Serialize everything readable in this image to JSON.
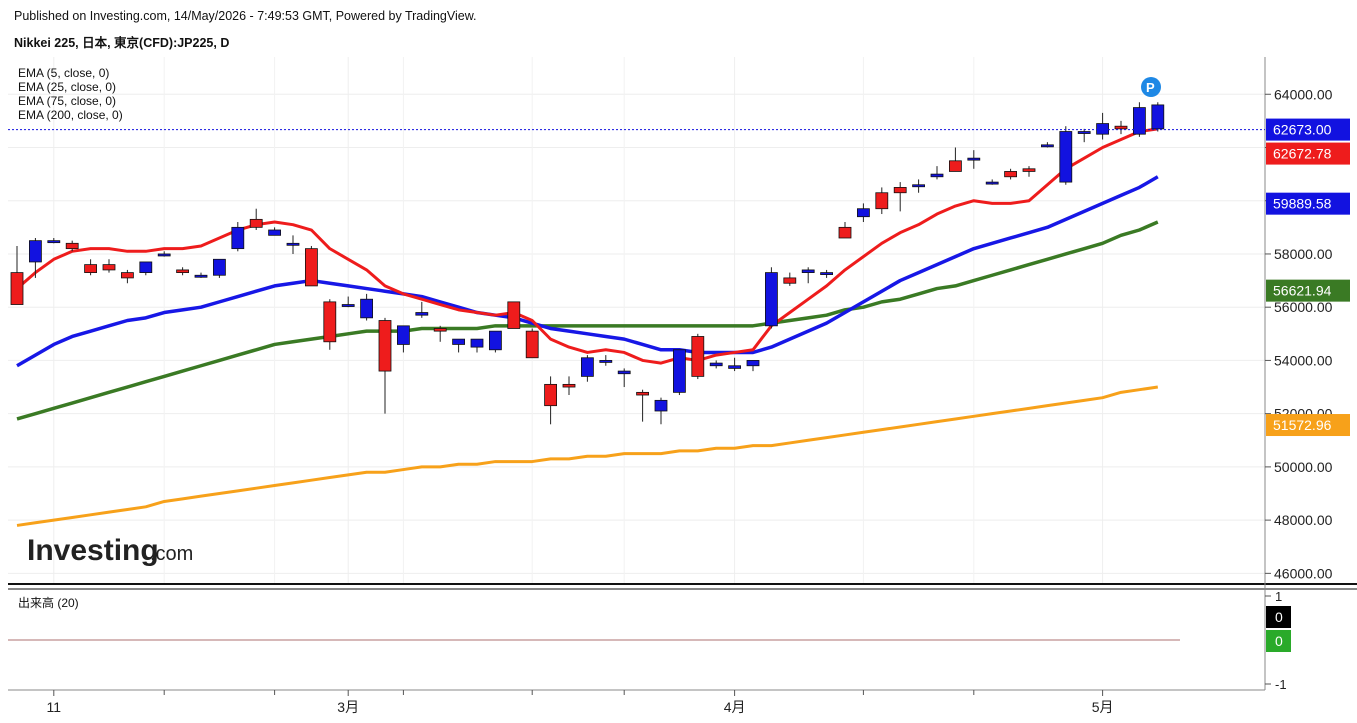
{
  "header": {
    "published": "Published on Investing.com, 14/May/2026 - 7:49:53 GMT, Powered by TradingView.",
    "title": "Nikkei 225, 日本, 東京(CFD):JP225, D"
  },
  "indicators": [
    {
      "label": "EMA (5, close, 0)",
      "color": "#ee1c1c"
    },
    {
      "label": "EMA (25, close, 0)",
      "color": "#1717e6"
    },
    {
      "label": "EMA (75, close, 0)",
      "color": "#3a7a24"
    },
    {
      "label": "EMA (200, close, 0)",
      "color": "#f7a11a"
    }
  ],
  "watermark": {
    "brand": "Investing",
    "suffix": ".com"
  },
  "marker_icon": "p-marker-icon",
  "volume": {
    "label": "出来高 (20)",
    "tick_top": "1",
    "tick_bottom": "-1",
    "value_black": "0",
    "value_green": "0"
  },
  "badges": [
    {
      "text": "62673.00",
      "bg": "#1212e0",
      "price": 62673.0
    },
    {
      "text": "62672.78",
      "bg": "#ee1c1c",
      "price": 62672.78
    },
    {
      "text": "59889.58",
      "bg": "#1212e0",
      "price": 59889.58
    },
    {
      "text": "56621.94",
      "bg": "#3a7a24",
      "price": 56621.94
    },
    {
      "text": "51572.96",
      "bg": "#f7a11a",
      "price": 51572.96
    }
  ],
  "chart_data": {
    "type": "candlestick",
    "price_axis": {
      "ticks": [
        "64000.00",
        "62000.00",
        "60000.00",
        "58000.00",
        "56000.00",
        "54000.00",
        "52000.00",
        "50000.00",
        "48000.00",
        "46000.00"
      ],
      "ylim": [
        45600,
        65400
      ]
    },
    "x_ticks": [
      {
        "label": "11",
        "index": 2
      },
      {
        "label": "3月",
        "index": 18
      },
      {
        "label": "4月",
        "index": 39
      },
      {
        "label": "5月",
        "index": 59
      }
    ],
    "candles": [
      {
        "o": 57300,
        "h": 58300,
        "l": 56400,
        "c": 56100
      },
      {
        "o": 57700,
        "h": 58600,
        "l": 57100,
        "c": 58500
      },
      {
        "o": 58500,
        "h": 58600,
        "l": 58400,
        "c": 58500
      },
      {
        "o": 58400,
        "h": 58500,
        "l": 58100,
        "c": 58200
      },
      {
        "o": 57600,
        "h": 57800,
        "l": 57200,
        "c": 57300
      },
      {
        "o": 57600,
        "h": 57800,
        "l": 57300,
        "c": 57400
      },
      {
        "o": 57300,
        "h": 57400,
        "l": 56900,
        "c": 57100
      },
      {
        "o": 57300,
        "h": 57700,
        "l": 57200,
        "c": 57700
      },
      {
        "o": 58000,
        "h": 58100,
        "l": 57900,
        "c": 58000
      },
      {
        "o": 57400,
        "h": 57500,
        "l": 57200,
        "c": 57300
      },
      {
        "o": 57200,
        "h": 57300,
        "l": 57100,
        "c": 57200
      },
      {
        "o": 57200,
        "h": 57800,
        "l": 57100,
        "c": 57800
      },
      {
        "o": 58200,
        "h": 59200,
        "l": 58100,
        "c": 59000
      },
      {
        "o": 59300,
        "h": 59700,
        "l": 58900,
        "c": 59000
      },
      {
        "o": 58700,
        "h": 59000,
        "l": 58700,
        "c": 58900
      },
      {
        "o": 58400,
        "h": 58700,
        "l": 58000,
        "c": 58400
      },
      {
        "o": 58200,
        "h": 58300,
        "l": 56900,
        "c": 56800
      },
      {
        "o": 56200,
        "h": 56300,
        "l": 54400,
        "c": 54700
      },
      {
        "o": 56100,
        "h": 56400,
        "l": 56000,
        "c": 56100
      },
      {
        "o": 55600,
        "h": 56500,
        "l": 55500,
        "c": 56300
      },
      {
        "o": 55500,
        "h": 55600,
        "l": 52000,
        "c": 53600
      },
      {
        "o": 54600,
        "h": 55100,
        "l": 54300,
        "c": 55300
      },
      {
        "o": 55700,
        "h": 56200,
        "l": 55600,
        "c": 55800
      },
      {
        "o": 55200,
        "h": 55300,
        "l": 54700,
        "c": 55100
      },
      {
        "o": 54600,
        "h": 54800,
        "l": 54300,
        "c": 54800
      },
      {
        "o": 54500,
        "h": 54800,
        "l": 54300,
        "c": 54800
      },
      {
        "o": 54400,
        "h": 55100,
        "l": 54300,
        "c": 55100
      },
      {
        "o": 56200,
        "h": 56200,
        "l": 55200,
        "c": 55200
      },
      {
        "o": 55100,
        "h": 55200,
        "l": 54100,
        "c": 54100
      },
      {
        "o": 53100,
        "h": 53400,
        "l": 51600,
        "c": 52300
      },
      {
        "o": 53100,
        "h": 53400,
        "l": 52700,
        "c": 53000
      },
      {
        "o": 53400,
        "h": 54200,
        "l": 53200,
        "c": 54100
      },
      {
        "o": 54000,
        "h": 54200,
        "l": 53800,
        "c": 54000
      },
      {
        "o": 53500,
        "h": 53700,
        "l": 53000,
        "c": 53600
      },
      {
        "o": 52800,
        "h": 52900,
        "l": 51700,
        "c": 52700
      },
      {
        "o": 52100,
        "h": 52600,
        "l": 51600,
        "c": 52500
      },
      {
        "o": 52800,
        "h": 54400,
        "l": 52700,
        "c": 54400
      },
      {
        "o": 54900,
        "h": 55000,
        "l": 53300,
        "c": 53400
      },
      {
        "o": 53800,
        "h": 54000,
        "l": 53700,
        "c": 53900
      },
      {
        "o": 53700,
        "h": 54100,
        "l": 53600,
        "c": 53800
      },
      {
        "o": 53800,
        "h": 54000,
        "l": 53600,
        "c": 54000
      },
      {
        "o": 55300,
        "h": 57500,
        "l": 55200,
        "c": 57300
      },
      {
        "o": 57100,
        "h": 57300,
        "l": 56800,
        "c": 56900
      },
      {
        "o": 57300,
        "h": 57500,
        "l": 56900,
        "c": 57400
      },
      {
        "o": 57300,
        "h": 57400,
        "l": 57100,
        "c": 57300
      },
      {
        "o": 59000,
        "h": 59200,
        "l": 58600,
        "c": 58600
      },
      {
        "o": 59400,
        "h": 59900,
        "l": 59200,
        "c": 59700
      },
      {
        "o": 60300,
        "h": 60500,
        "l": 59500,
        "c": 59700
      },
      {
        "o": 60500,
        "h": 60700,
        "l": 59600,
        "c": 60300
      },
      {
        "o": 60600,
        "h": 60800,
        "l": 60300,
        "c": 60600
      },
      {
        "o": 60900,
        "h": 61300,
        "l": 60800,
        "c": 61000
      },
      {
        "o": 61500,
        "h": 62000,
        "l": 61100,
        "c": 61100
      },
      {
        "o": 61600,
        "h": 61900,
        "l": 61200,
        "c": 61600
      },
      {
        "o": 60700,
        "h": 60800,
        "l": 60600,
        "c": 60700
      },
      {
        "o": 61100,
        "h": 61200,
        "l": 60800,
        "c": 60900
      },
      {
        "o": 61200,
        "h": 61300,
        "l": 60900,
        "c": 61100
      },
      {
        "o": 62100,
        "h": 62200,
        "l": 62000,
        "c": 62100
      },
      {
        "o": 60700,
        "h": 62800,
        "l": 60600,
        "c": 62600
      },
      {
        "o": 62600,
        "h": 62700,
        "l": 62200,
        "c": 62600
      },
      {
        "o": 62500,
        "h": 63300,
        "l": 62300,
        "c": 62900
      },
      {
        "o": 62800,
        "h": 63000,
        "l": 62500,
        "c": 62700
      },
      {
        "o": 62500,
        "h": 63700,
        "l": 62400,
        "c": 63500
      },
      {
        "o": 62700,
        "h": 63700,
        "l": 62600,
        "c": 63600
      }
    ],
    "ema5": [
      56700,
      57300,
      57800,
      58100,
      58200,
      58200,
      58100,
      58100,
      58200,
      58200,
      58300,
      58600,
      58900,
      59100,
      59200,
      59100,
      58900,
      58200,
      57800,
      57400,
      56800,
      56500,
      56300,
      56100,
      55900,
      55800,
      55700,
      55800,
      55500,
      54800,
      54500,
      54300,
      54400,
      54300,
      54000,
      53900,
      54100,
      54000,
      54200,
      54300,
      54400,
      55300,
      55800,
      56300,
      56800,
      57400,
      57900,
      58400,
      58800,
      59100,
      59500,
      59800,
      60000,
      59900,
      59900,
      60000,
      60600,
      61200,
      61600,
      62000,
      62300,
      62600,
      62700
    ],
    "ema25": [
      53800,
      54200,
      54600,
      54900,
      55100,
      55300,
      55500,
      55600,
      55800,
      55900,
      56000,
      56200,
      56400,
      56600,
      56800,
      56900,
      57000,
      56900,
      56800,
      56700,
      56600,
      56500,
      56400,
      56200,
      56000,
      55800,
      55700,
      55600,
      55400,
      55200,
      55100,
      55000,
      54900,
      54800,
      54600,
      54400,
      54400,
      54300,
      54300,
      54300,
      54300,
      54500,
      54800,
      55100,
      55400,
      55800,
      56200,
      56600,
      57000,
      57300,
      57600,
      57900,
      58200,
      58400,
      58600,
      58800,
      59000,
      59300,
      59600,
      59900,
      60200,
      60500,
      60900
    ],
    "ema75": [
      51800,
      52000,
      52200,
      52400,
      52600,
      52800,
      53000,
      53200,
      53400,
      53600,
      53800,
      54000,
      54200,
      54400,
      54600,
      54700,
      54800,
      54900,
      55000,
      55100,
      55100,
      55100,
      55200,
      55200,
      55200,
      55200,
      55300,
      55300,
      55300,
      55300,
      55300,
      55300,
      55300,
      55300,
      55300,
      55300,
      55300,
      55300,
      55300,
      55300,
      55300,
      55400,
      55500,
      55600,
      55700,
      55900,
      56000,
      56200,
      56300,
      56500,
      56700,
      56800,
      57000,
      57200,
      57400,
      57600,
      57800,
      58000,
      58200,
      58400,
      58700,
      58900,
      59200
    ],
    "ema200": [
      47800,
      47900,
      48000,
      48100,
      48200,
      48300,
      48400,
      48500,
      48700,
      48800,
      48900,
      49000,
      49100,
      49200,
      49300,
      49400,
      49500,
      49600,
      49700,
      49800,
      49800,
      49900,
      50000,
      50000,
      50100,
      50100,
      50200,
      50200,
      50200,
      50300,
      50300,
      50400,
      50400,
      50500,
      50500,
      50500,
      50600,
      50600,
      50700,
      50700,
      50800,
      50800,
      50900,
      51000,
      51100,
      51200,
      51300,
      51400,
      51500,
      51600,
      51700,
      51800,
      51900,
      52000,
      52100,
      52200,
      52300,
      52400,
      52500,
      52600,
      52800,
      52900,
      53000
    ]
  }
}
